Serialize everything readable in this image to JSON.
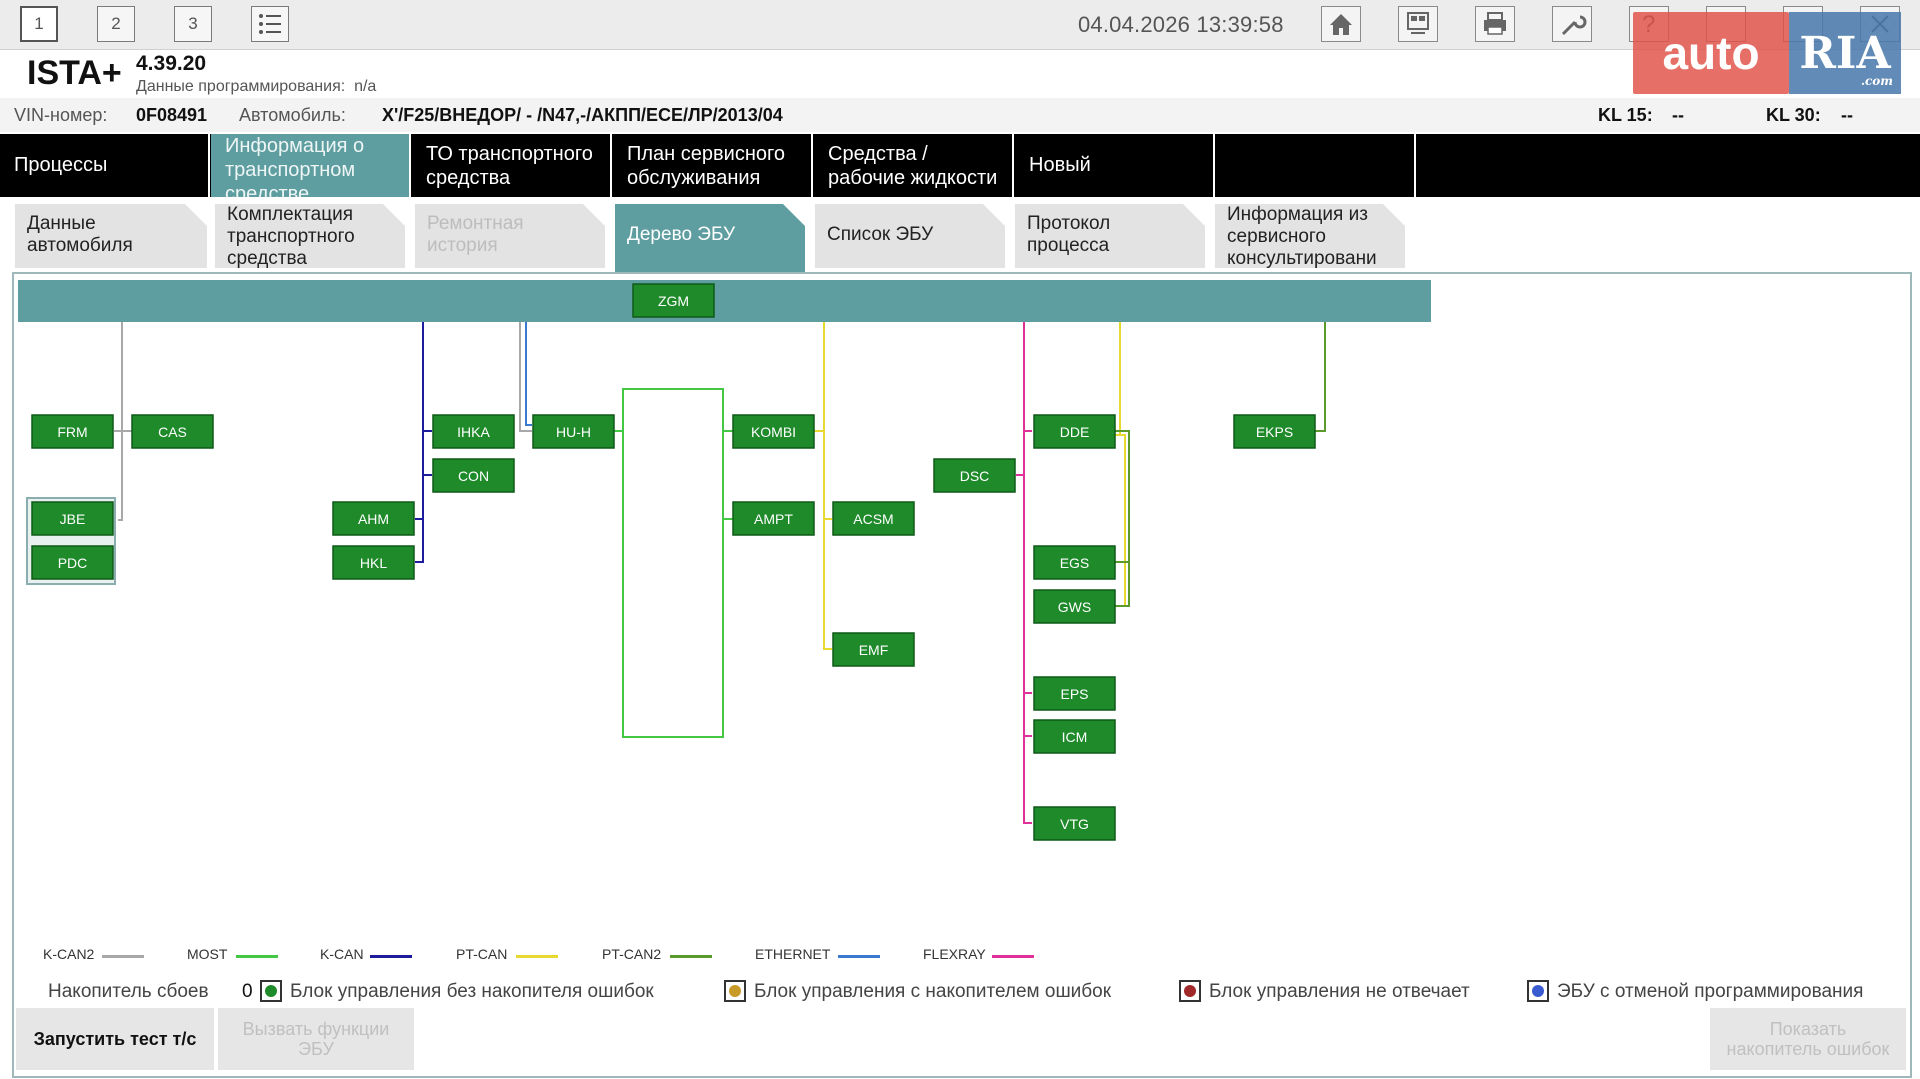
{
  "toolbar": {
    "buttons": [
      "1",
      "2",
      "3"
    ],
    "datetime": "04.04.2026 13:39:58",
    "icons": [
      "list-icon",
      "home-icon",
      "ecu-icon",
      "print-icon",
      "wrench-icon",
      "help-icon",
      "save-icon",
      "window-icon",
      "close-icon",
      "settings-icon"
    ]
  },
  "watermark": {
    "auto": "auto",
    "ria": "RIA",
    "com": ".com"
  },
  "header": {
    "app_name": "ISTA+",
    "version": "4.39.20",
    "prog_label": "Данные программирования:",
    "prog_value": "n/a"
  },
  "vehicle": {
    "vin_label": "VIN-номер:",
    "vin": "0F08491",
    "car_label": "Автомобиль:",
    "car": "X'/F25/ВНЕДОР/ - /N47,-/АКПП/ECE/ЛР/2013/04",
    "kl15_label": "KL 15:",
    "kl15": "--",
    "kl30_label": "KL 30:",
    "kl30": "--"
  },
  "main_tabs": [
    "Процессы",
    "Информация о транспортном средстве",
    "ТО транспортного средства",
    "План сервисного обслуживания",
    "Средства / рабочие жидкости",
    "Новый"
  ],
  "sub_tabs": [
    "Данные автомобиля",
    "Комплектация транспортного средства",
    "Ремонтная история",
    "Дерево ЭБУ",
    "Список ЭБУ",
    "Протокол процесса",
    "Информация из сервисного консультировани"
  ],
  "ecus": {
    "zgm": "ZGM",
    "frm": "FRM",
    "cas": "CAS",
    "jbe": "JBE",
    "pdc": "PDC",
    "ihka": "IHKA",
    "con": "CON",
    "ahm": "AHM",
    "hkl": "HKL",
    "huh": "HU-H",
    "kombi": "KOMBI",
    "ampt": "AMPT",
    "acsm": "ACSM",
    "emf": "EMF",
    "dsc": "DSC",
    "dde": "DDE",
    "egs": "EGS",
    "gws": "GWS",
    "eps": "EPS",
    "icm": "ICM",
    "vtg": "VTG",
    "ekps": "EKPS"
  },
  "buses": [
    {
      "name": "K-CAN2",
      "color": "#a8a8a8"
    },
    {
      "name": "MOST",
      "color": "#44c844"
    },
    {
      "name": "K-CAN",
      "color": "#1c1c9c"
    },
    {
      "name": "PT-CAN",
      "color": "#e8d830"
    },
    {
      "name": "PT-CAN2",
      "color": "#5a9a2a"
    },
    {
      "name": "ETHERNET",
      "color": "#3a7ad0"
    },
    {
      "name": "FLEXRAY",
      "color": "#e0309a"
    }
  ],
  "status_legend": {
    "fault_memory_label": "Накопитель сбоев",
    "fault_memory_count": "0",
    "items": [
      {
        "label": "Блок управления без накопителя ошибок",
        "color": "#1e8a2a"
      },
      {
        "label": "Блок управления с накопителем ошибок",
        "color": "#c89a28"
      },
      {
        "label": "Блок управления не отвечает",
        "color": "#a02828"
      },
      {
        "label": "ЭБУ с отменой программирования",
        "color": "#3a5ad0"
      }
    ]
  },
  "bottom_buttons": {
    "start_test": "Запустить тест т/с",
    "call_functions": "Вызвать функции ЭБУ",
    "show_memory": "Показать накопитель ошибок"
  }
}
